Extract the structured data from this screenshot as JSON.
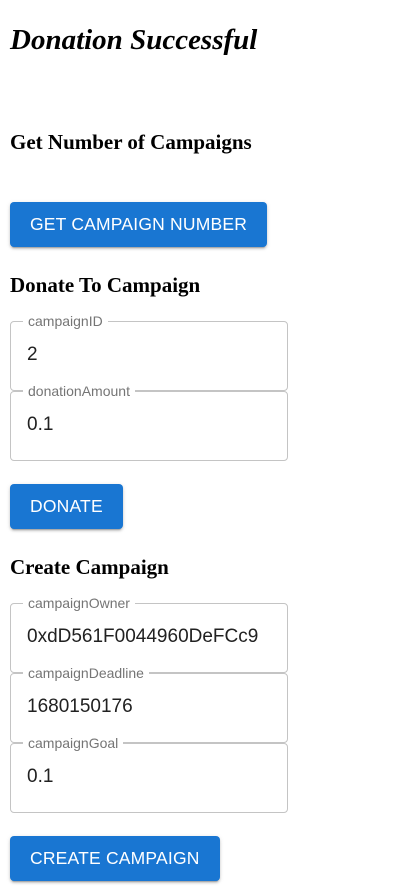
{
  "status": {
    "message": "Donation Successful"
  },
  "get_campaigns": {
    "title": "Get Number of Campaigns",
    "button_label": "GET CAMPAIGN NUMBER"
  },
  "donate": {
    "title": "Donate To Campaign",
    "campaign_id": {
      "label": "campaignID",
      "value": "2"
    },
    "donation_amount": {
      "label": "donationAmount",
      "value": "0.1"
    },
    "button_label": "DONATE"
  },
  "create": {
    "title": "Create Campaign",
    "campaign_owner": {
      "label": "campaignOwner",
      "value": "0xdD561F0044960DeFCc9"
    },
    "campaign_deadline": {
      "label": "campaignDeadline",
      "value": "1680150176"
    },
    "campaign_goal": {
      "label": "campaignGoal",
      "value": "0.1"
    },
    "button_label": "CREATE CAMPAIGN"
  },
  "colors": {
    "primary": "#1976d2",
    "border": "#c4c4c4",
    "label": "#757575"
  }
}
